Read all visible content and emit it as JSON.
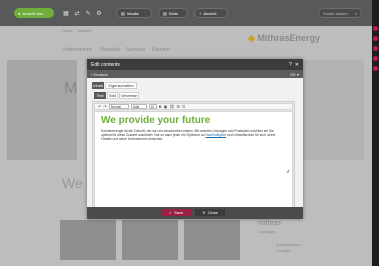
{
  "cms_bar": {
    "status_label": "Ansicht ans",
    "pill_1": "Inhalte",
    "pill_2": "Seite",
    "pill_3": "Ansicht",
    "search_placeholder": "Suche starten"
  },
  "site": {
    "nav_top": "Home",
    "nav_top_2": "Aktuelle",
    "brand": "MithrasEnergy",
    "menu": [
      "Unternehmen",
      "Produkte",
      "Services",
      "Karriere"
    ],
    "hero_letter": "M",
    "section_title": "We",
    "side_title": "mithras",
    "side_sub": "Lösungen",
    "news_1": "Energieeffizienz",
    "news_2": "Lösungen",
    "colors": {
      "brand_green": "#6fae3a",
      "accent": "#c2185b"
    }
  },
  "modal": {
    "title": "Edit contents",
    "language": "Deutsch",
    "language_right": "DE",
    "tabs": [
      "Inhalt",
      "Eigenschaften"
    ],
    "sub_tabs": [
      "Text",
      "Bild",
      "Verweise"
    ],
    "toolbar": {
      "style_select": "Normal",
      "font_select": "Arial",
      "size_select": "10"
    },
    "headline": "We provide your future",
    "body_pre": "Sonnenenergie ist die Zukunft, der wir uns verschrieben haben. Mit unseren Lösungen und Produkten möchten wir Sie optimal für diese Zukunft ausrüsten. Nur so kann jeder ein Optimum an ",
    "body_link": "Nachhaltigkeit",
    "body_post": " und Umweltschutz für sich, seine Familie und seine Unternehmen erreichen.",
    "save_label": "Save",
    "close_label": "Close"
  }
}
